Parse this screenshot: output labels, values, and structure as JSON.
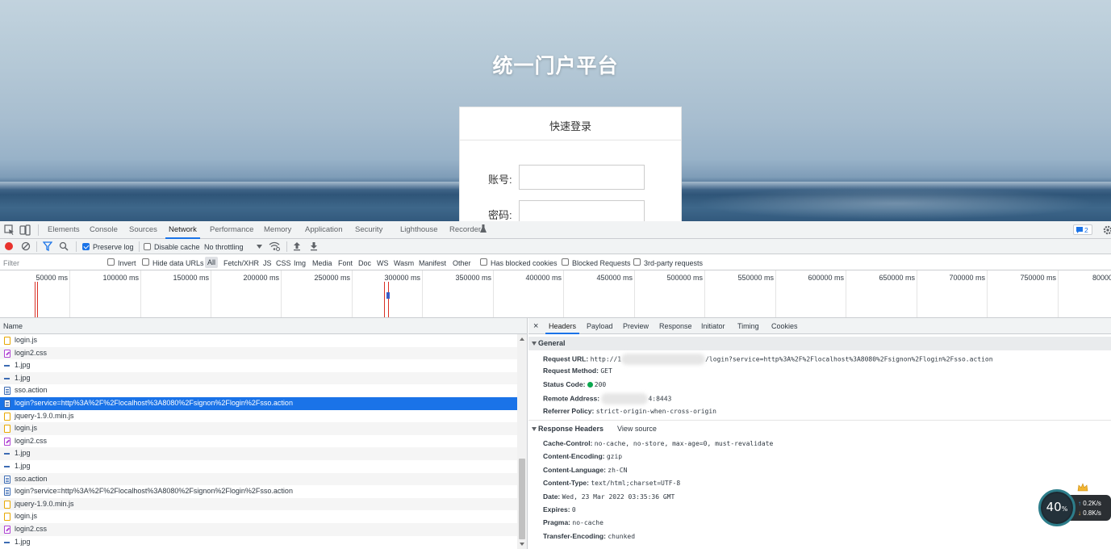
{
  "page": {
    "title": "统一门户平台",
    "login_header": "快速登录",
    "account_label": "账号:",
    "password_label": "密码:"
  },
  "devtools": {
    "tabs": [
      "Elements",
      "Console",
      "Sources",
      "Network",
      "Performance",
      "Memory",
      "Application",
      "Security",
      "Lighthouse",
      "Recorder"
    ],
    "active_tab": "Network",
    "issues_count": "2",
    "toolbar": {
      "preserve_log": "Preserve log",
      "disable_cache": "Disable cache",
      "throttling": "No throttling"
    },
    "filter": {
      "placeholder": "Filter",
      "invert": "Invert",
      "hide_data_urls": "Hide data URLs",
      "types": [
        "All",
        "Fetch/XHR",
        "JS",
        "CSS",
        "Img",
        "Media",
        "Font",
        "Doc",
        "WS",
        "Wasm",
        "Manifest",
        "Other"
      ],
      "has_blocked_cookies": "Has blocked cookies",
      "blocked_requests": "Blocked Requests",
      "third_party": "3rd-party requests"
    },
    "timeline_ticks": [
      "50000 ms",
      "100000 ms",
      "150000 ms",
      "200000 ms",
      "250000 ms",
      "300000 ms",
      "350000 ms",
      "400000 ms",
      "450000 ms",
      "500000 ms",
      "550000 ms",
      "600000 ms",
      "650000 ms",
      "700000 ms",
      "750000 ms",
      "80000"
    ],
    "list_header": "Name",
    "requests": [
      {
        "name": "login.js",
        "type": "js"
      },
      {
        "name": "login2.css",
        "type": "css"
      },
      {
        "name": "1.jpg",
        "type": "img"
      },
      {
        "name": "1.jpg",
        "type": "img"
      },
      {
        "name": "sso.action",
        "type": "doc"
      },
      {
        "name": "login?service=http%3A%2F%2Flocalhost%3A8080%2Fsignon%2Flogin%2Fsso.action",
        "type": "doc",
        "selected": true
      },
      {
        "name": "jquery-1.9.0.min.js",
        "type": "js"
      },
      {
        "name": "login.js",
        "type": "js"
      },
      {
        "name": "login2.css",
        "type": "css"
      },
      {
        "name": "1.jpg",
        "type": "img"
      },
      {
        "name": "1.jpg",
        "type": "img"
      },
      {
        "name": "sso.action",
        "type": "doc"
      },
      {
        "name": "login?service=http%3A%2F%2Flocalhost%3A8080%2Fsignon%2Flogin%2Fsso.action",
        "type": "doc"
      },
      {
        "name": "jquery-1.9.0.min.js",
        "type": "js"
      },
      {
        "name": "login.js",
        "type": "js"
      },
      {
        "name": "login2.css",
        "type": "css"
      },
      {
        "name": "1.jpg",
        "type": "img"
      }
    ],
    "detail_tabs": [
      "Headers",
      "Payload",
      "Preview",
      "Response",
      "Initiator",
      "Timing",
      "Cookies"
    ],
    "general": {
      "title": "General",
      "request_url_label": "Request URL:",
      "request_url_prefix": "http://1",
      "request_url_suffix": "/login?service=http%3A%2F%2Flocalhost%3A8080%2Fsignon%2Flogin%2Fsso.action",
      "request_method_label": "Request Method:",
      "request_method": "GET",
      "status_code_label": "Status Code:",
      "status_code": "200",
      "remote_address_label": "Remote Address:",
      "remote_address_suffix": "4:8443",
      "referrer_policy_label": "Referrer Policy:",
      "referrer_policy": "strict-origin-when-cross-origin"
    },
    "response_headers": {
      "title": "Response Headers",
      "view_source": "View source",
      "items": [
        {
          "k": "Cache-Control:",
          "v": "no-cache, no-store, max-age=0, must-revalidate"
        },
        {
          "k": "Content-Encoding:",
          "v": "gzip"
        },
        {
          "k": "Content-Language:",
          "v": "zh-CN"
        },
        {
          "k": "Content-Type:",
          "v": "text/html;charset=UTF-8"
        },
        {
          "k": "Date:",
          "v": "Wed, 23 Mar 2022 03:35:36 GMT"
        },
        {
          "k": "Expires:",
          "v": "0"
        },
        {
          "k": "Pragma:",
          "v": "no-cache"
        },
        {
          "k": "Transfer-Encoding:",
          "v": "chunked"
        }
      ]
    }
  },
  "speed_widget": {
    "percent": "40",
    "percent_unit": "%",
    "upload": "0.2K/s",
    "download": "0.8K/s"
  }
}
